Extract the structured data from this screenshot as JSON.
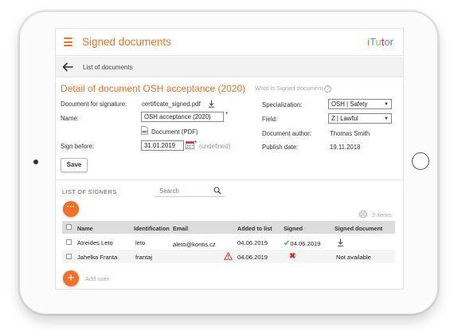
{
  "header": {
    "title": "Signed documents",
    "logo": [
      "i",
      "T",
      "u",
      "t",
      "o",
      "r"
    ],
    "logo_colors": [
      "#f2712a",
      "#2ea8e0",
      "#8bc34a",
      "#9c27b0",
      "#e94d8a",
      "#2e7dd7"
    ]
  },
  "breadcrumb": {
    "label": "List of documents"
  },
  "detail": {
    "title": "Detail of document OSH acceptance (2020)",
    "help_text": "What is Signed document",
    "doc_for_signature_label": "Document for signature:",
    "doc_for_signature_value": "certificate_signed.pdf",
    "name_label": "Name:",
    "name_value": "OSH acceptance (2020)",
    "required_mark": "*",
    "document_link": "Document (PDF)",
    "sign_before_label": "Sign before:",
    "sign_before_value": "31.01.2019",
    "undefined_label": "(undefined)",
    "specialization_label": "Specialization:",
    "specialization_value": "OSH | Safety",
    "field_label": "Field:",
    "field_value": "Z | Lawful",
    "author_label": "Document author:",
    "author_value": "Thomas Smith",
    "publish_label": "Publish date:",
    "publish_value": "19.11.2018",
    "save_label": "Save"
  },
  "signers": {
    "title": "LIST OF SIGNERS",
    "search_placeholder": "Search",
    "more_label": "···",
    "items_count": "2 items",
    "columns": [
      "Name",
      "Identification",
      "Email",
      "Added to list",
      "Signed",
      "Signed document"
    ],
    "rows": [
      {
        "name": "Atreides Leto",
        "id": "leto",
        "email": "aleto@kontis.cz",
        "added": "04.06.2019",
        "signed": "04.06.2019",
        "signed_status": "yes",
        "document": ""
      },
      {
        "name": "Jahelka Franta",
        "id": "frantaj",
        "email": "",
        "added": "04.06.2019",
        "signed": "",
        "signed_status": "no",
        "document": "Not available"
      }
    ],
    "add_user_label": "Add user",
    "add_icon": "+"
  }
}
